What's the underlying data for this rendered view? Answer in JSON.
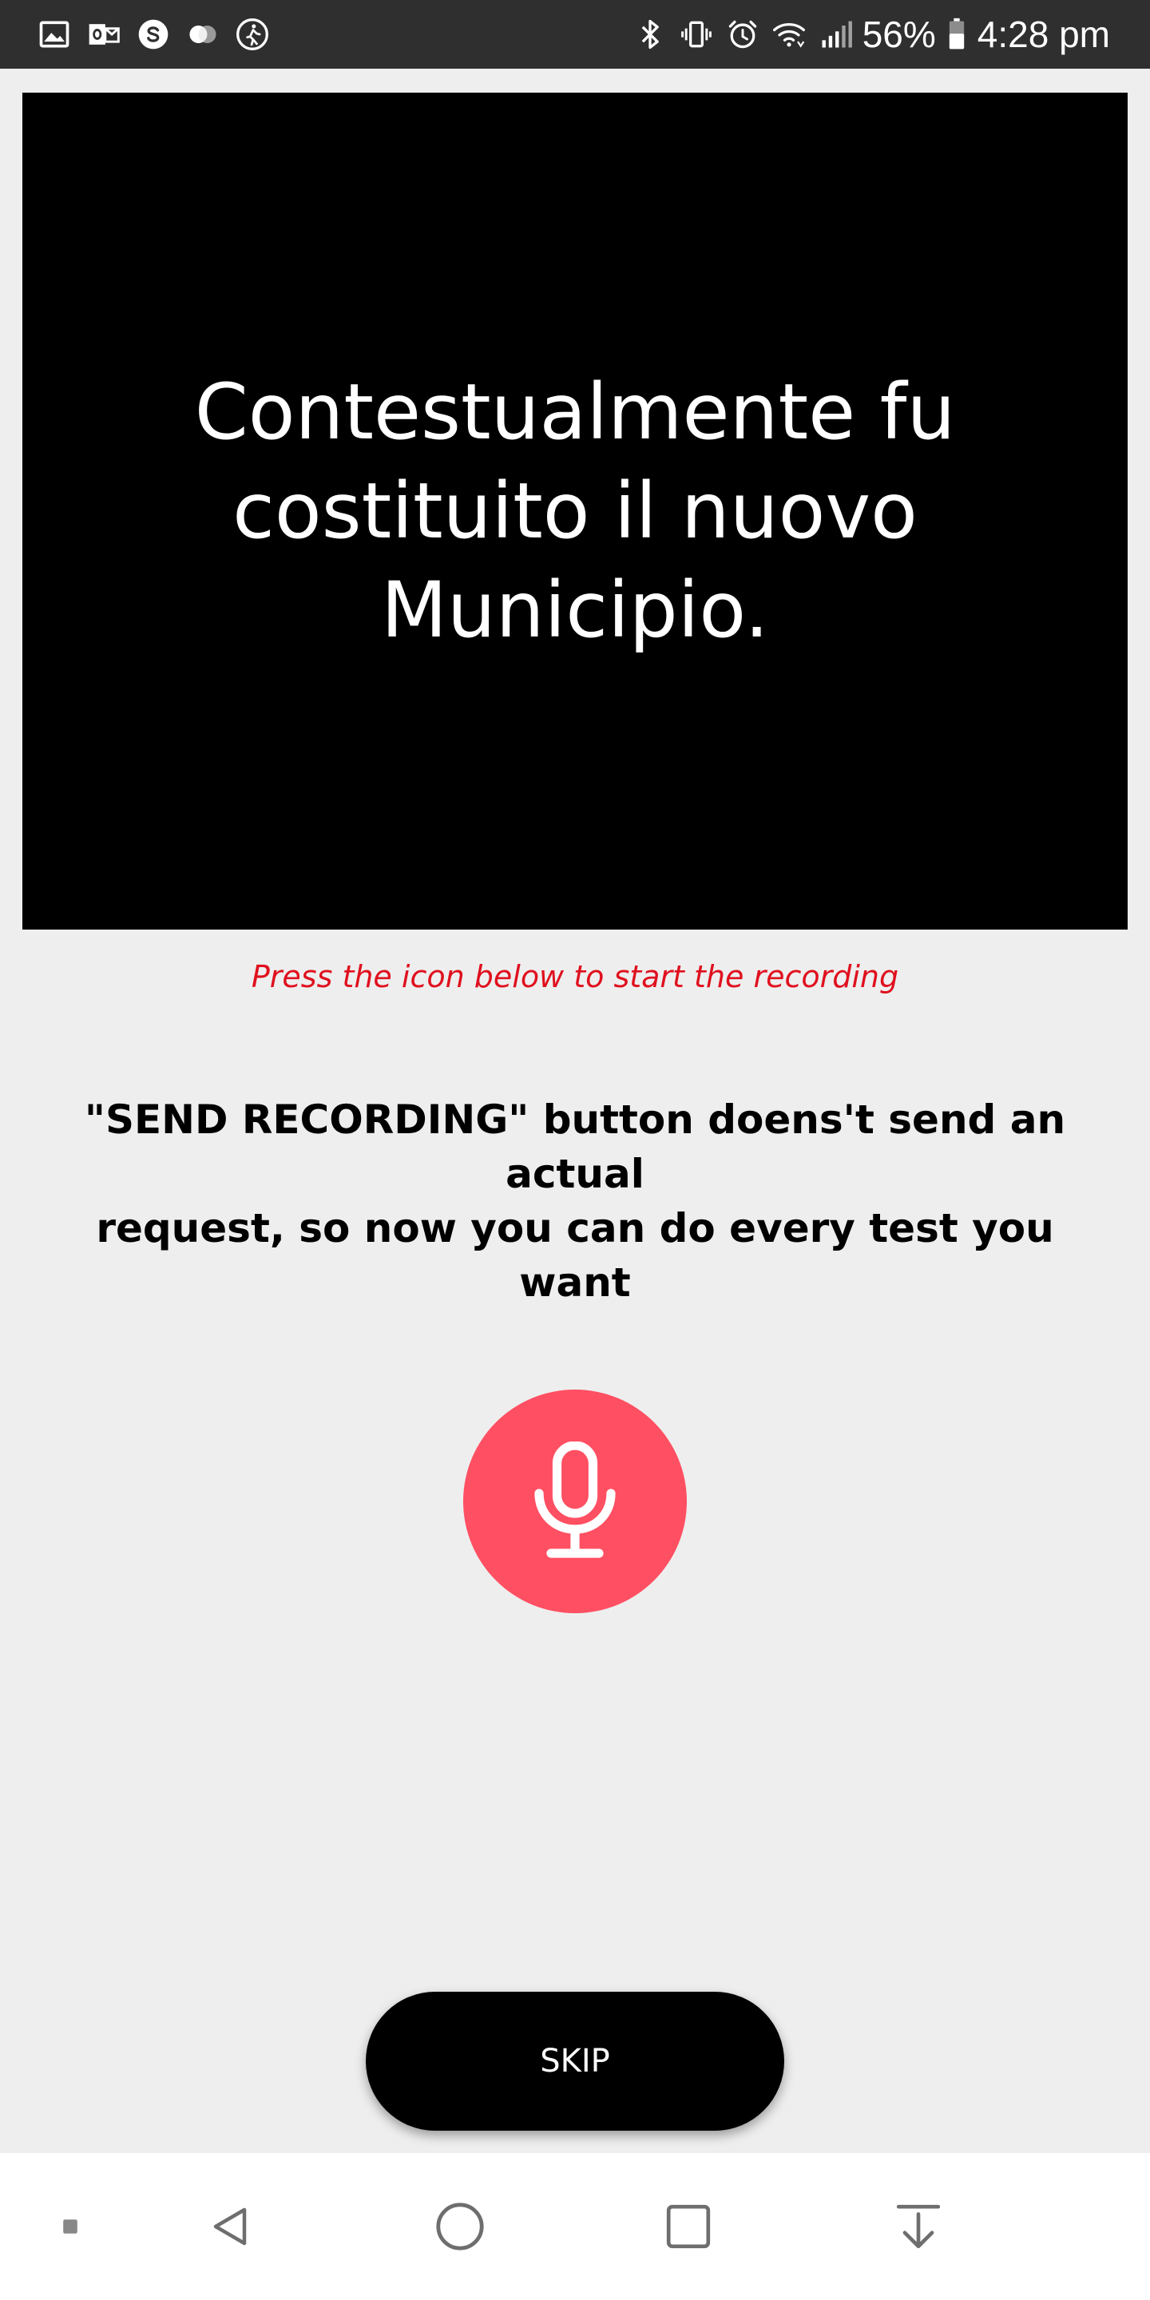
{
  "status_bar": {
    "left_icons": [
      "gallery-icon",
      "outlook-icon",
      "skype-icon",
      "toggle-icon",
      "walking-icon"
    ],
    "right_icons": [
      "bluetooth-icon",
      "vibrate-icon",
      "alarm-icon",
      "wifi-icon",
      "signal-icon"
    ],
    "battery_percent": "56%",
    "time": "4:28 pm"
  },
  "prompt": {
    "line1": "Contestualmente fu",
    "line2": "costituito il nuovo Municipio."
  },
  "hint": "Press the icon below to start the recording",
  "info": {
    "line1": "\"SEND RECORDING\" button doens't send an actual",
    "line2": "request, so now you can do every test you want"
  },
  "mic_button": {
    "icon": "microphone-icon"
  },
  "skip_button": {
    "label": "SKIP"
  },
  "nav_bar": {
    "items": [
      "dot-icon",
      "back-icon",
      "home-icon",
      "recents-icon",
      "notification-pull-icon"
    ]
  },
  "colors": {
    "status_bar_bg": "#2F2F2F",
    "background": "#EEEEEE",
    "card_bg": "#000000",
    "hint": "#E0101E",
    "mic_button": "#FF4F62",
    "skip_button_bg": "#000000",
    "nav_bar_bg": "#FFFFFF"
  }
}
